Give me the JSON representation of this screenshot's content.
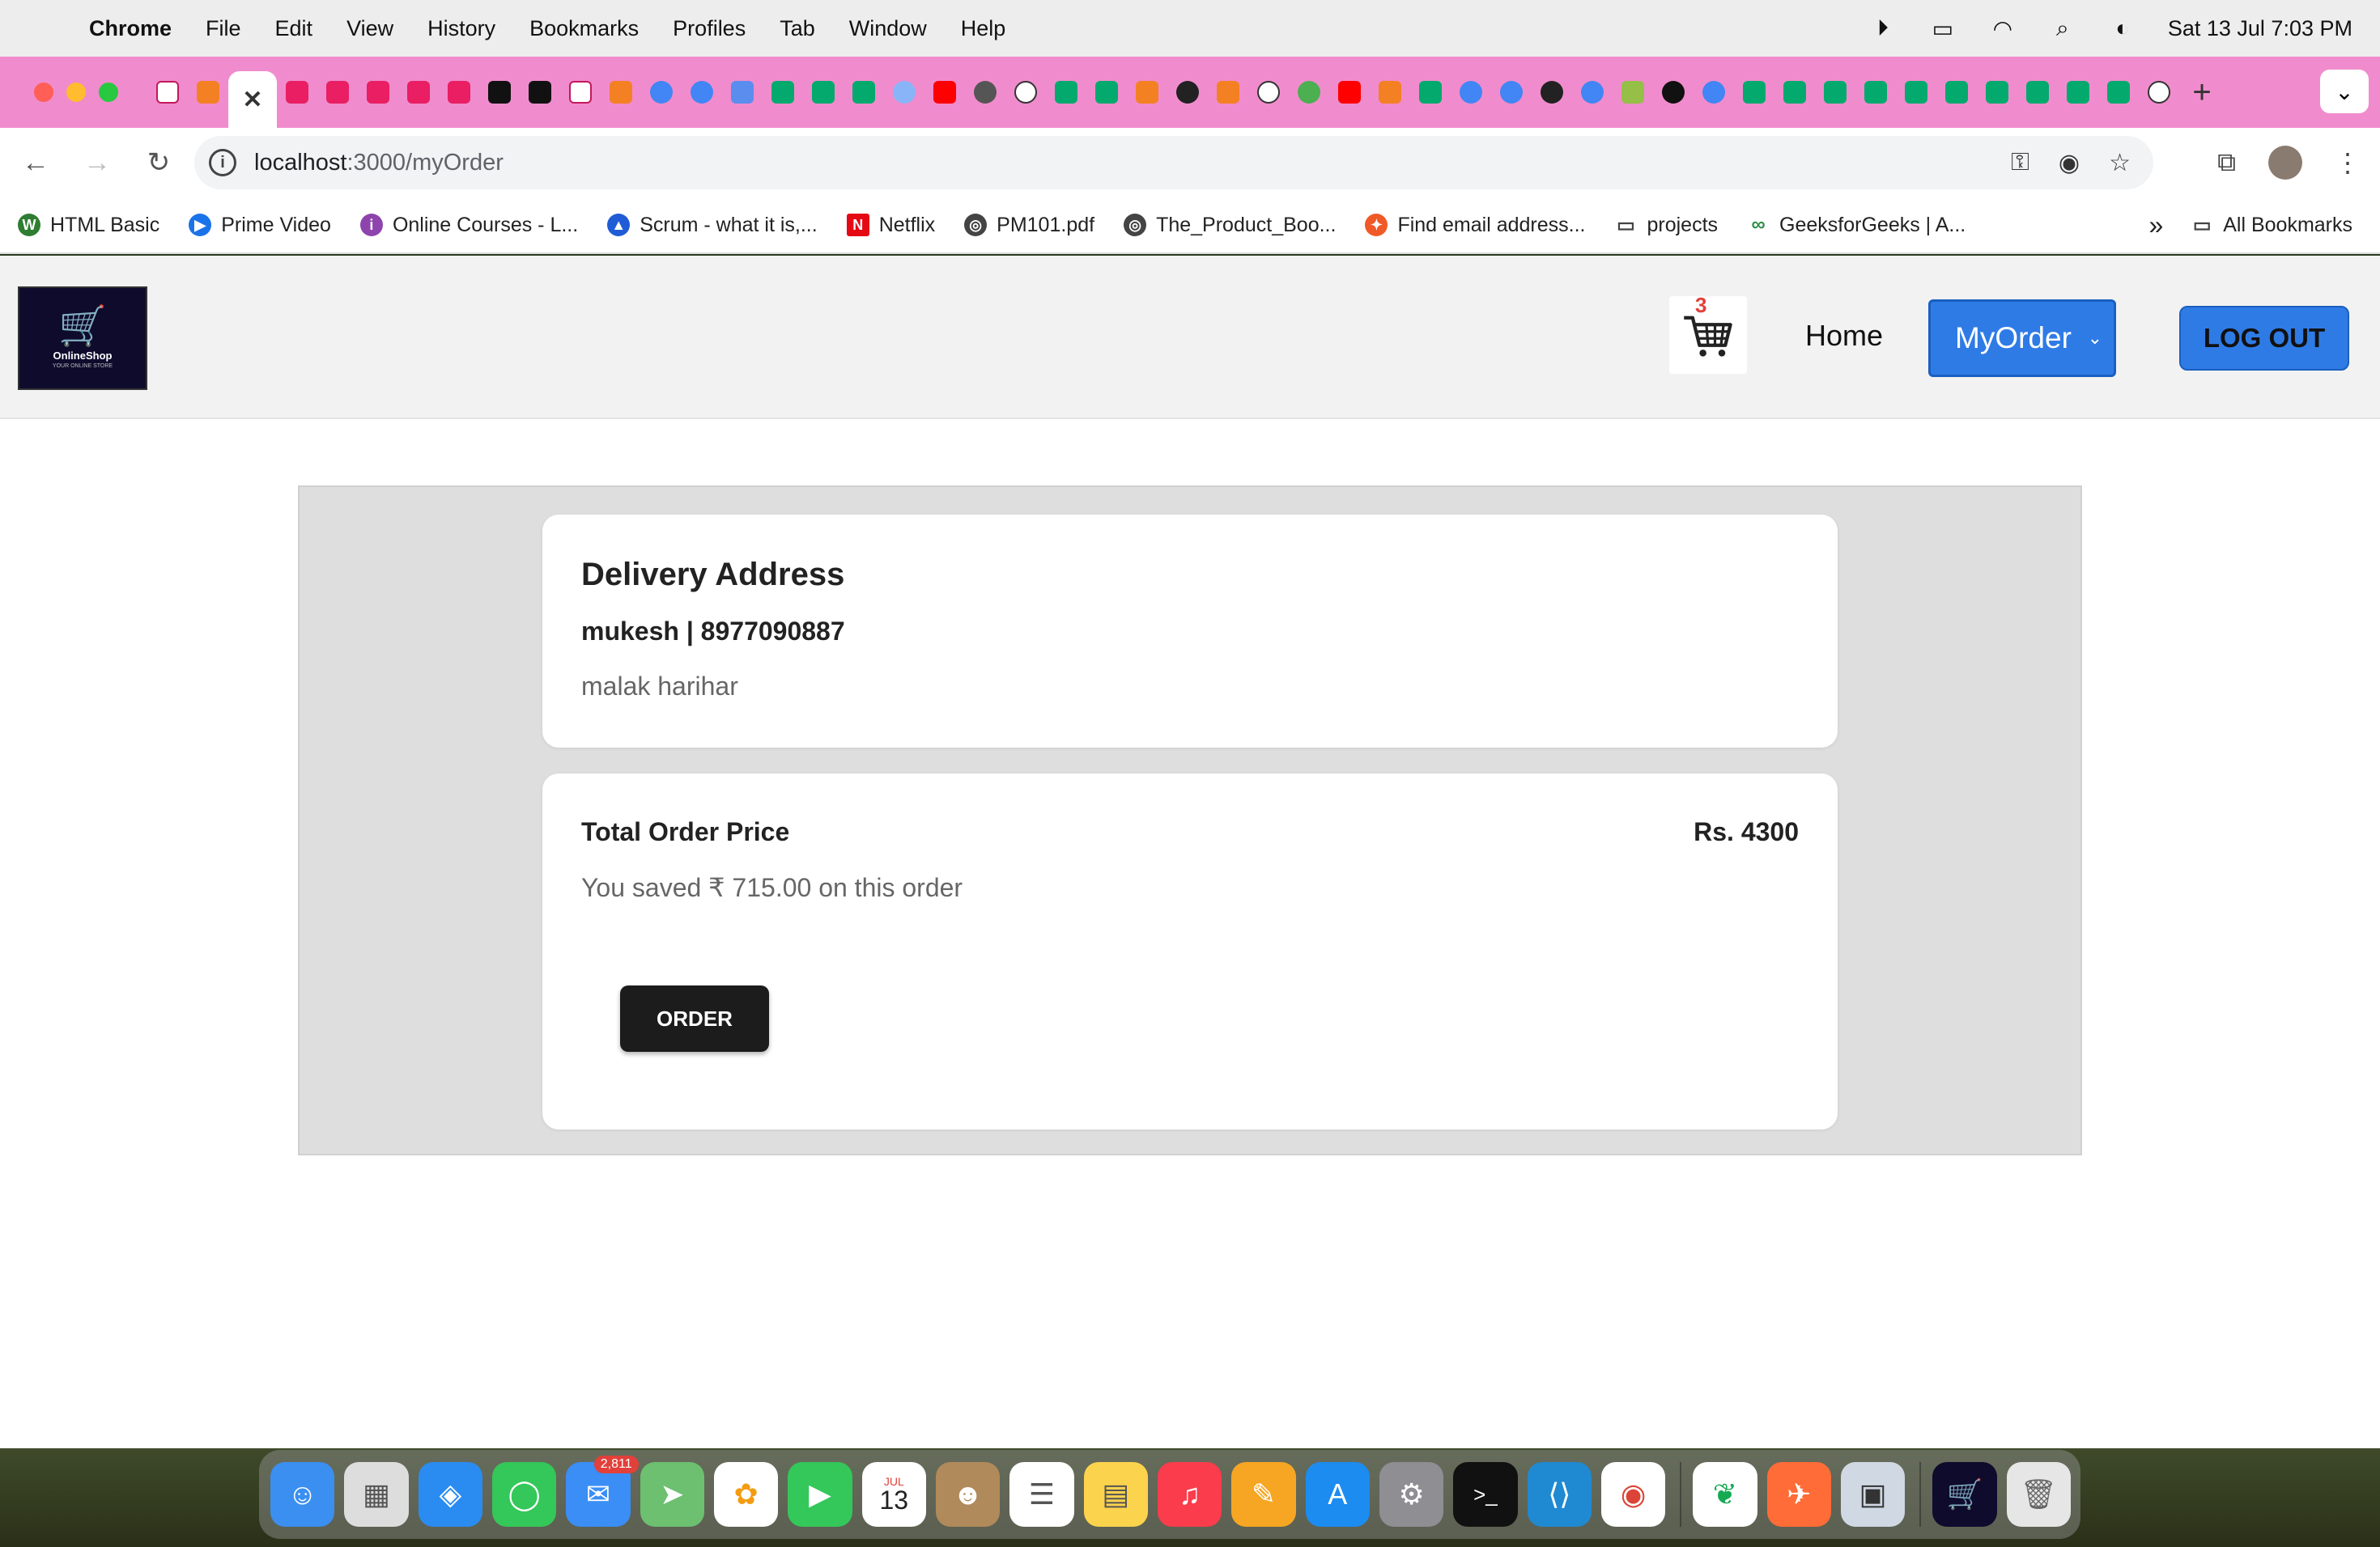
{
  "menubar": {
    "app": "Chrome",
    "items": [
      "File",
      "Edit",
      "View",
      "History",
      "Bookmarks",
      "Profiles",
      "Tab",
      "Window",
      "Help"
    ],
    "clock": "Sat 13 Jul  7:03 PM"
  },
  "tabs": {
    "active_close": "✕",
    "new_tab": "+"
  },
  "address_bar": {
    "host": "localhost",
    "path": ":3000/myOrder"
  },
  "bookmarks": {
    "items": [
      {
        "label": "HTML Basic",
        "color": "#2e7d32",
        "icon": "W"
      },
      {
        "label": "Prime Video",
        "color": "#1a73e8",
        "icon": "▶"
      },
      {
        "label": "Online Courses - L...",
        "color": "#8e44ad",
        "icon": "i"
      },
      {
        "label": "Scrum - what it is,...",
        "color": "#1f5cd6",
        "icon": "▲"
      },
      {
        "label": "Netflix",
        "color": "#e50914",
        "icon": "N"
      },
      {
        "label": "PM101.pdf",
        "color": "#444444",
        "icon": "◎"
      },
      {
        "label": "The_Product_Boo...",
        "color": "#444444",
        "icon": "◎"
      },
      {
        "label": "Find email address...",
        "color": "#f05a28",
        "icon": "✦"
      },
      {
        "label": "projects",
        "color": "#ffffff",
        "icon": "▭"
      },
      {
        "label": "GeeksforGeeks | A...",
        "color": "#2f8d46",
        "icon": "∞"
      }
    ],
    "overflow": "»",
    "all": "All Bookmarks"
  },
  "navbar": {
    "logo_text": "OnlineShop",
    "logo_sub": "YOUR ONLINE STORE",
    "cart_count": "3",
    "home": "Home",
    "myorder": "MyOrder",
    "logout": "LOG OUT"
  },
  "address_card": {
    "title": "Delivery Address",
    "contact": "mukesh | 8977090887",
    "address": "malak harihar"
  },
  "total_card": {
    "label": "Total Order Price",
    "value": "Rs. 4300",
    "saved": "You saved ₹ 715.00 on this order",
    "order_button": "ORDER"
  },
  "dock": {
    "mail_badge": "2,811",
    "calendar_month": "JUL",
    "calendar_day": "13"
  }
}
